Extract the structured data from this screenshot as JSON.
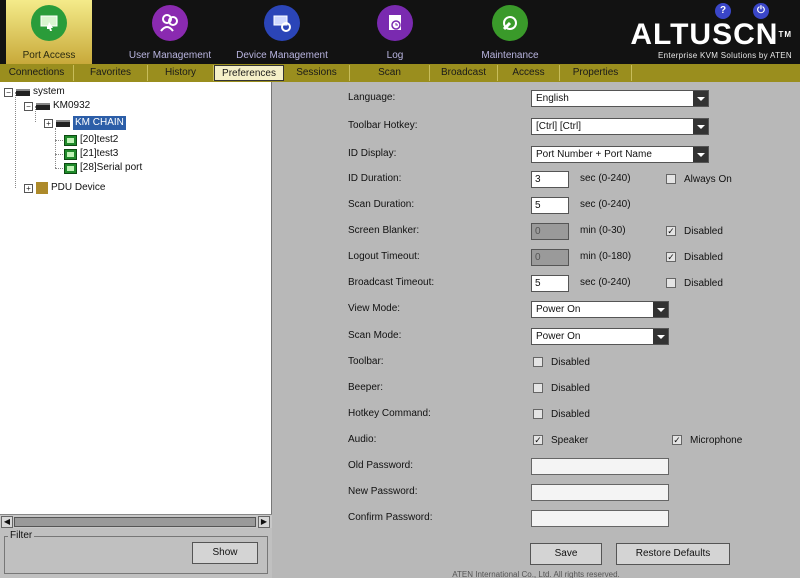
{
  "topbar": {
    "items": [
      {
        "label": "Port Access",
        "active": true,
        "color": "#2a9c3a",
        "icon": "monitor-hand-icon"
      },
      {
        "label": "User Management",
        "active": false,
        "color": "#8a2ab0",
        "icon": "users-icon"
      },
      {
        "label": "Device Management",
        "active": false,
        "color": "#2b45b8",
        "icon": "device-gear-icon"
      },
      {
        "label": "Log",
        "active": false,
        "color": "#7a2ab0",
        "icon": "log-clock-icon"
      },
      {
        "label": "Maintenance",
        "active": false,
        "color": "#3a9a2a",
        "icon": "wrench-icon"
      }
    ],
    "help_glyph": "?",
    "logout_glyph": "⏻"
  },
  "brand": {
    "name": "ALTUSCN",
    "trademark": "TM",
    "tagline": "Enterprise KVM Solutions by ATEN"
  },
  "tabs": [
    "Connections",
    "Favorites",
    "History",
    "Preferences",
    "Sessions",
    "Scan",
    "Broadcast",
    "Access",
    "Properties"
  ],
  "active_tab": "Preferences",
  "tree": {
    "root": "system",
    "host": "KM0932",
    "chain": "KM CHAIN",
    "ports": [
      "[20]test2",
      "[21]test3",
      "[28]Serial port"
    ],
    "pdu": "PDU Device"
  },
  "filter": {
    "legend": "Filter",
    "show_label": "Show"
  },
  "prefs": {
    "language": {
      "label": "Language:",
      "value": "English"
    },
    "toolbar_hotkey": {
      "label": "Toolbar Hotkey:",
      "value": "[Ctrl] [Ctrl]"
    },
    "id_display": {
      "label": "ID Display:",
      "value": "Port Number + Port Name"
    },
    "id_duration": {
      "label": "ID Duration:",
      "value": "3",
      "range": "sec (0-240)",
      "option": "Always On",
      "checked": false
    },
    "scan_duration": {
      "label": "Scan Duration:",
      "value": "5",
      "range": "sec (0-240)"
    },
    "screen_blanker": {
      "label": "Screen Blanker:",
      "value": "0",
      "range": "min (0-30)",
      "option": "Disabled",
      "checked": true
    },
    "logout_timeout": {
      "label": "Logout Timeout:",
      "value": "0",
      "range": "min (0-180)",
      "option": "Disabled",
      "checked": true
    },
    "broadcast_timeout": {
      "label": "Broadcast Timeout:",
      "value": "5",
      "range": "sec (0-240)",
      "option": "Disabled",
      "checked": false
    },
    "view_mode": {
      "label": "View Mode:",
      "value": "Power On"
    },
    "scan_mode": {
      "label": "Scan Mode:",
      "value": "Power On"
    },
    "toolbar": {
      "label": "Toolbar:",
      "option": "Disabled",
      "checked": false
    },
    "beeper": {
      "label": "Beeper:",
      "option": "Disabled",
      "checked": false
    },
    "hotkey_command": {
      "label": "Hotkey Command:",
      "option": "Disabled",
      "checked": false
    },
    "audio": {
      "label": "Audio:",
      "speaker": "Speaker",
      "speaker_checked": true,
      "microphone": "Microphone",
      "microphone_checked": true
    },
    "old_password": {
      "label": "Old Password:"
    },
    "new_password": {
      "label": "New Password:"
    },
    "confirm_password": {
      "label": "Confirm Password:"
    },
    "save_label": "Save",
    "restore_label": "Restore Defaults"
  },
  "checkmark_glyph": "✓",
  "footer": "ATEN International Co., Ltd. All rights reserved."
}
